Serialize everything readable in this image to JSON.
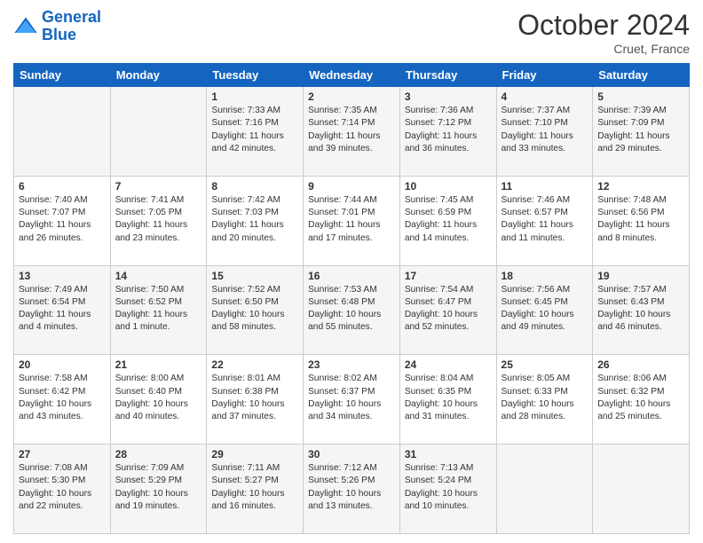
{
  "header": {
    "logo_line1": "General",
    "logo_line2": "Blue",
    "month": "October 2024",
    "location": "Cruet, France"
  },
  "days_of_week": [
    "Sunday",
    "Monday",
    "Tuesday",
    "Wednesday",
    "Thursday",
    "Friday",
    "Saturday"
  ],
  "weeks": [
    [
      {
        "day": "",
        "info": ""
      },
      {
        "day": "",
        "info": ""
      },
      {
        "day": "1",
        "sunrise": "7:33 AM",
        "sunset": "7:16 PM",
        "daylight": "11 hours and 42 minutes."
      },
      {
        "day": "2",
        "sunrise": "7:35 AM",
        "sunset": "7:14 PM",
        "daylight": "11 hours and 39 minutes."
      },
      {
        "day": "3",
        "sunrise": "7:36 AM",
        "sunset": "7:12 PM",
        "daylight": "11 hours and 36 minutes."
      },
      {
        "day": "4",
        "sunrise": "7:37 AM",
        "sunset": "7:10 PM",
        "daylight": "11 hours and 33 minutes."
      },
      {
        "day": "5",
        "sunrise": "7:39 AM",
        "sunset": "7:09 PM",
        "daylight": "11 hours and 29 minutes."
      }
    ],
    [
      {
        "day": "6",
        "sunrise": "7:40 AM",
        "sunset": "7:07 PM",
        "daylight": "11 hours and 26 minutes."
      },
      {
        "day": "7",
        "sunrise": "7:41 AM",
        "sunset": "7:05 PM",
        "daylight": "11 hours and 23 minutes."
      },
      {
        "day": "8",
        "sunrise": "7:42 AM",
        "sunset": "7:03 PM",
        "daylight": "11 hours and 20 minutes."
      },
      {
        "day": "9",
        "sunrise": "7:44 AM",
        "sunset": "7:01 PM",
        "daylight": "11 hours and 17 minutes."
      },
      {
        "day": "10",
        "sunrise": "7:45 AM",
        "sunset": "6:59 PM",
        "daylight": "11 hours and 14 minutes."
      },
      {
        "day": "11",
        "sunrise": "7:46 AM",
        "sunset": "6:57 PM",
        "daylight": "11 hours and 11 minutes."
      },
      {
        "day": "12",
        "sunrise": "7:48 AM",
        "sunset": "6:56 PM",
        "daylight": "11 hours and 8 minutes."
      }
    ],
    [
      {
        "day": "13",
        "sunrise": "7:49 AM",
        "sunset": "6:54 PM",
        "daylight": "11 hours and 4 minutes."
      },
      {
        "day": "14",
        "sunrise": "7:50 AM",
        "sunset": "6:52 PM",
        "daylight": "11 hours and 1 minute."
      },
      {
        "day": "15",
        "sunrise": "7:52 AM",
        "sunset": "6:50 PM",
        "daylight": "10 hours and 58 minutes."
      },
      {
        "day": "16",
        "sunrise": "7:53 AM",
        "sunset": "6:48 PM",
        "daylight": "10 hours and 55 minutes."
      },
      {
        "day": "17",
        "sunrise": "7:54 AM",
        "sunset": "6:47 PM",
        "daylight": "10 hours and 52 minutes."
      },
      {
        "day": "18",
        "sunrise": "7:56 AM",
        "sunset": "6:45 PM",
        "daylight": "10 hours and 49 minutes."
      },
      {
        "day": "19",
        "sunrise": "7:57 AM",
        "sunset": "6:43 PM",
        "daylight": "10 hours and 46 minutes."
      }
    ],
    [
      {
        "day": "20",
        "sunrise": "7:58 AM",
        "sunset": "6:42 PM",
        "daylight": "10 hours and 43 minutes."
      },
      {
        "day": "21",
        "sunrise": "8:00 AM",
        "sunset": "6:40 PM",
        "daylight": "10 hours and 40 minutes."
      },
      {
        "day": "22",
        "sunrise": "8:01 AM",
        "sunset": "6:38 PM",
        "daylight": "10 hours and 37 minutes."
      },
      {
        "day": "23",
        "sunrise": "8:02 AM",
        "sunset": "6:37 PM",
        "daylight": "10 hours and 34 minutes."
      },
      {
        "day": "24",
        "sunrise": "8:04 AM",
        "sunset": "6:35 PM",
        "daylight": "10 hours and 31 minutes."
      },
      {
        "day": "25",
        "sunrise": "8:05 AM",
        "sunset": "6:33 PM",
        "daylight": "10 hours and 28 minutes."
      },
      {
        "day": "26",
        "sunrise": "8:06 AM",
        "sunset": "6:32 PM",
        "daylight": "10 hours and 25 minutes."
      }
    ],
    [
      {
        "day": "27",
        "sunrise": "7:08 AM",
        "sunset": "5:30 PM",
        "daylight": "10 hours and 22 minutes."
      },
      {
        "day": "28",
        "sunrise": "7:09 AM",
        "sunset": "5:29 PM",
        "daylight": "10 hours and 19 minutes."
      },
      {
        "day": "29",
        "sunrise": "7:11 AM",
        "sunset": "5:27 PM",
        "daylight": "10 hours and 16 minutes."
      },
      {
        "day": "30",
        "sunrise": "7:12 AM",
        "sunset": "5:26 PM",
        "daylight": "10 hours and 13 minutes."
      },
      {
        "day": "31",
        "sunrise": "7:13 AM",
        "sunset": "5:24 PM",
        "daylight": "10 hours and 10 minutes."
      },
      {
        "day": "",
        "info": ""
      },
      {
        "day": "",
        "info": ""
      }
    ]
  ],
  "labels": {
    "sunrise": "Sunrise:",
    "sunset": "Sunset:",
    "daylight": "Daylight:"
  }
}
